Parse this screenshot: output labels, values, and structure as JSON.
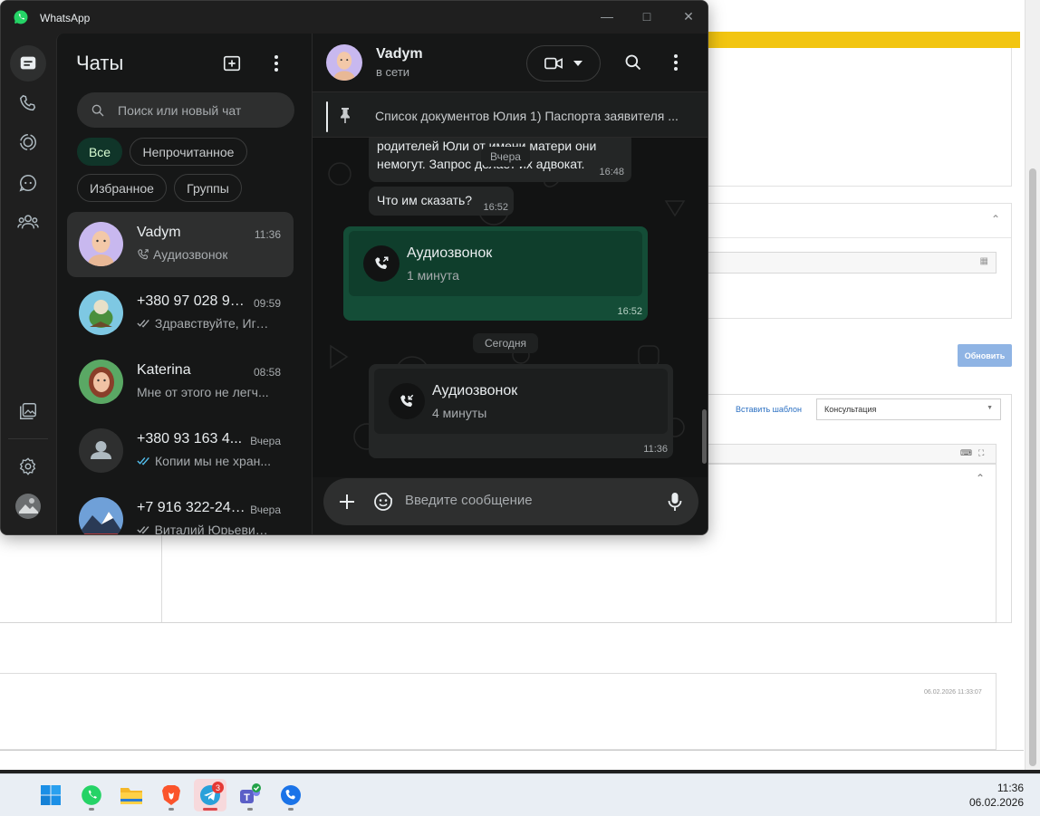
{
  "window": {
    "app_title": "WhatsApp"
  },
  "sidebar": {
    "header_title": "Чаты"
  },
  "search": {
    "placeholder": "Поиск или новый чат"
  },
  "filters": [
    {
      "label": "Все",
      "active": true
    },
    {
      "label": "Непрочитанное"
    },
    {
      "label": "Избранное"
    },
    {
      "label": "Группы"
    }
  ],
  "chats": [
    {
      "name": "Vadym",
      "time": "11:36",
      "preview": "Аудиозвонок",
      "preview_icon": "call-outgoing-icon",
      "selected": true
    },
    {
      "name": "+380 97 028 99...",
      "time": "09:59",
      "preview": "Здравствуйте, Иго...",
      "preview_icon": "double-check-icon"
    },
    {
      "name": "Katerina",
      "time": "08:58",
      "preview": "Мне от этого не легч..."
    },
    {
      "name": "+380 93 163 4...",
      "time": "Вчера",
      "preview": "Копии мы не хран...",
      "preview_icon": "double-check-read-icon"
    },
    {
      "name": "+7 916 322-24-...",
      "time": "Вчера",
      "preview": "Виталий Юрьевич,...",
      "preview_icon": "double-check-icon"
    }
  ],
  "conversation": {
    "contact_name": "Vadym",
    "contact_status": "в сети",
    "pinned_text": "Список документов Юлия 1) Паспорта заявителя ...",
    "messages": [
      {
        "text_line1": "родителей Юли от имени матери они",
        "text_line2": "немогут. Запрос делает их адвокат.",
        "time": "16:48"
      },
      {
        "text": "Что им сказать?",
        "time": "16:52"
      }
    ],
    "date_yesterday": "Вчера",
    "date_today": "Сегодня",
    "call_out": {
      "title": "Аудиозвонок",
      "duration": "1 минута",
      "time": "16:52"
    },
    "call_in": {
      "title": "Аудиозвонок",
      "duration": "4 минуты",
      "time": "11:36"
    },
    "composer_placeholder": "Введите сообщение"
  },
  "background_page": {
    "refresh_button": "Обновить",
    "insert_template_link": "Вставить шаблон",
    "template_select_value": "Консультация",
    "timestamp": "06.02.2026 11:33:07"
  },
  "taskbar": {
    "telegram_badge": "3",
    "clock_time": "11:36",
    "clock_date": "06.02.2026"
  },
  "colors": {
    "accent_green": "#25d366",
    "outgoing_bubble": "#144d37",
    "active_chip": "#103529"
  }
}
